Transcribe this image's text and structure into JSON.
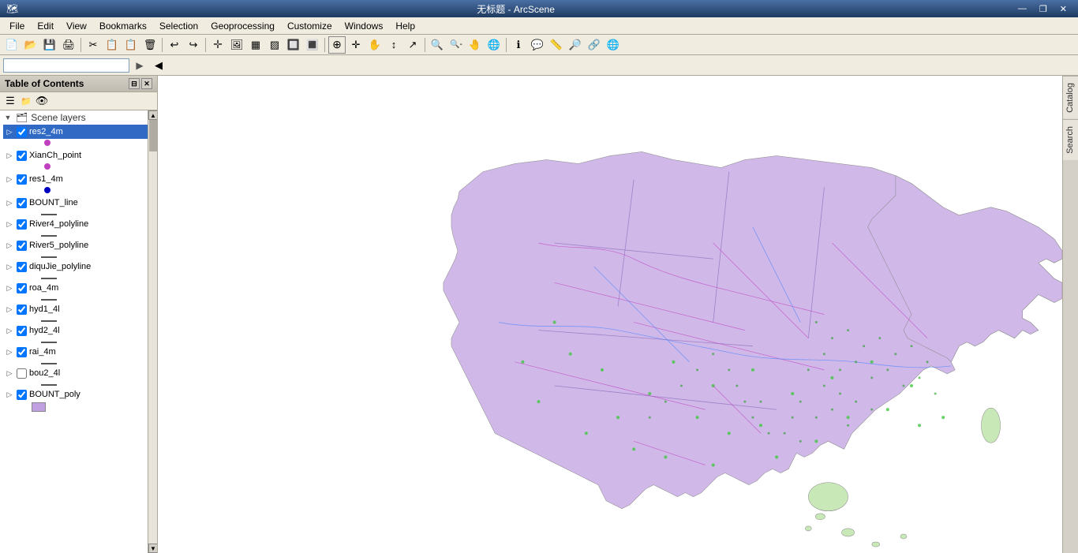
{
  "titlebar": {
    "title": "无标题 - ArcScene",
    "minimize": "—",
    "maximize": "❐",
    "close": "✕"
  },
  "menubar": {
    "items": [
      "File",
      "Edit",
      "View",
      "Bookmarks",
      "Selection",
      "Geoprocessing",
      "Customize",
      "Windows",
      "Help"
    ]
  },
  "toc": {
    "header": "Table of Contents",
    "scene_group": "Scene layers",
    "layers": [
      {
        "name": "res2_4m",
        "checked": true,
        "selected": true,
        "symbol_type": "point",
        "symbol_color": "#c040c0",
        "indent": 1
      },
      {
        "name": "XianCh_point",
        "checked": true,
        "selected": false,
        "symbol_type": "point",
        "symbol_color": "#c040c0",
        "indent": 1
      },
      {
        "name": "res1_4m",
        "checked": true,
        "selected": false,
        "symbol_type": "point",
        "symbol_color": "#0000c0",
        "indent": 1
      },
      {
        "name": "BOUNT_line",
        "checked": true,
        "selected": false,
        "symbol_type": "line",
        "symbol_color": "#000000",
        "indent": 1
      },
      {
        "name": "River4_polyline",
        "checked": true,
        "selected": false,
        "symbol_type": "line",
        "symbol_color": "#000000",
        "indent": 1
      },
      {
        "name": "River5_polyline",
        "checked": true,
        "selected": false,
        "symbol_type": "line",
        "symbol_color": "#000000",
        "indent": 1
      },
      {
        "name": "diquJie_polyline",
        "checked": true,
        "selected": false,
        "symbol_type": "line",
        "symbol_color": "#000000",
        "indent": 1
      },
      {
        "name": "roa_4m",
        "checked": true,
        "selected": false,
        "symbol_type": "line",
        "symbol_color": "#000000",
        "indent": 1
      },
      {
        "name": "hyd1_4l",
        "checked": true,
        "selected": false,
        "symbol_type": "line",
        "symbol_color": "#000000",
        "indent": 1
      },
      {
        "name": "hyd2_4l",
        "checked": true,
        "selected": false,
        "symbol_type": "line",
        "symbol_color": "#000000",
        "indent": 1
      },
      {
        "name": "rai_4m",
        "checked": true,
        "selected": false,
        "symbol_type": "line",
        "symbol_color": "#000000",
        "indent": 1
      },
      {
        "name": "bou2_4l",
        "checked": false,
        "selected": false,
        "symbol_type": "line",
        "symbol_color": "#000000",
        "indent": 1
      },
      {
        "name": "BOUNT_poly",
        "checked": true,
        "selected": false,
        "symbol_type": "fill",
        "symbol_color": "#c0a0e0",
        "indent": 1
      }
    ]
  },
  "right_sidebar": {
    "tabs": [
      "Catalog",
      "Search"
    ]
  },
  "toolbar1": {
    "buttons": [
      "📄",
      "📂",
      "💾",
      "🖨",
      "✂",
      "📋",
      "📋",
      "🗑",
      "↩",
      "↪",
      "✛",
      "🖼",
      "▦",
      "▨",
      "🔲",
      "🔳",
      "◻",
      "➕",
      "▶"
    ]
  },
  "toolbar2": {
    "search_placeholder": ""
  },
  "map": {
    "background": "white"
  }
}
